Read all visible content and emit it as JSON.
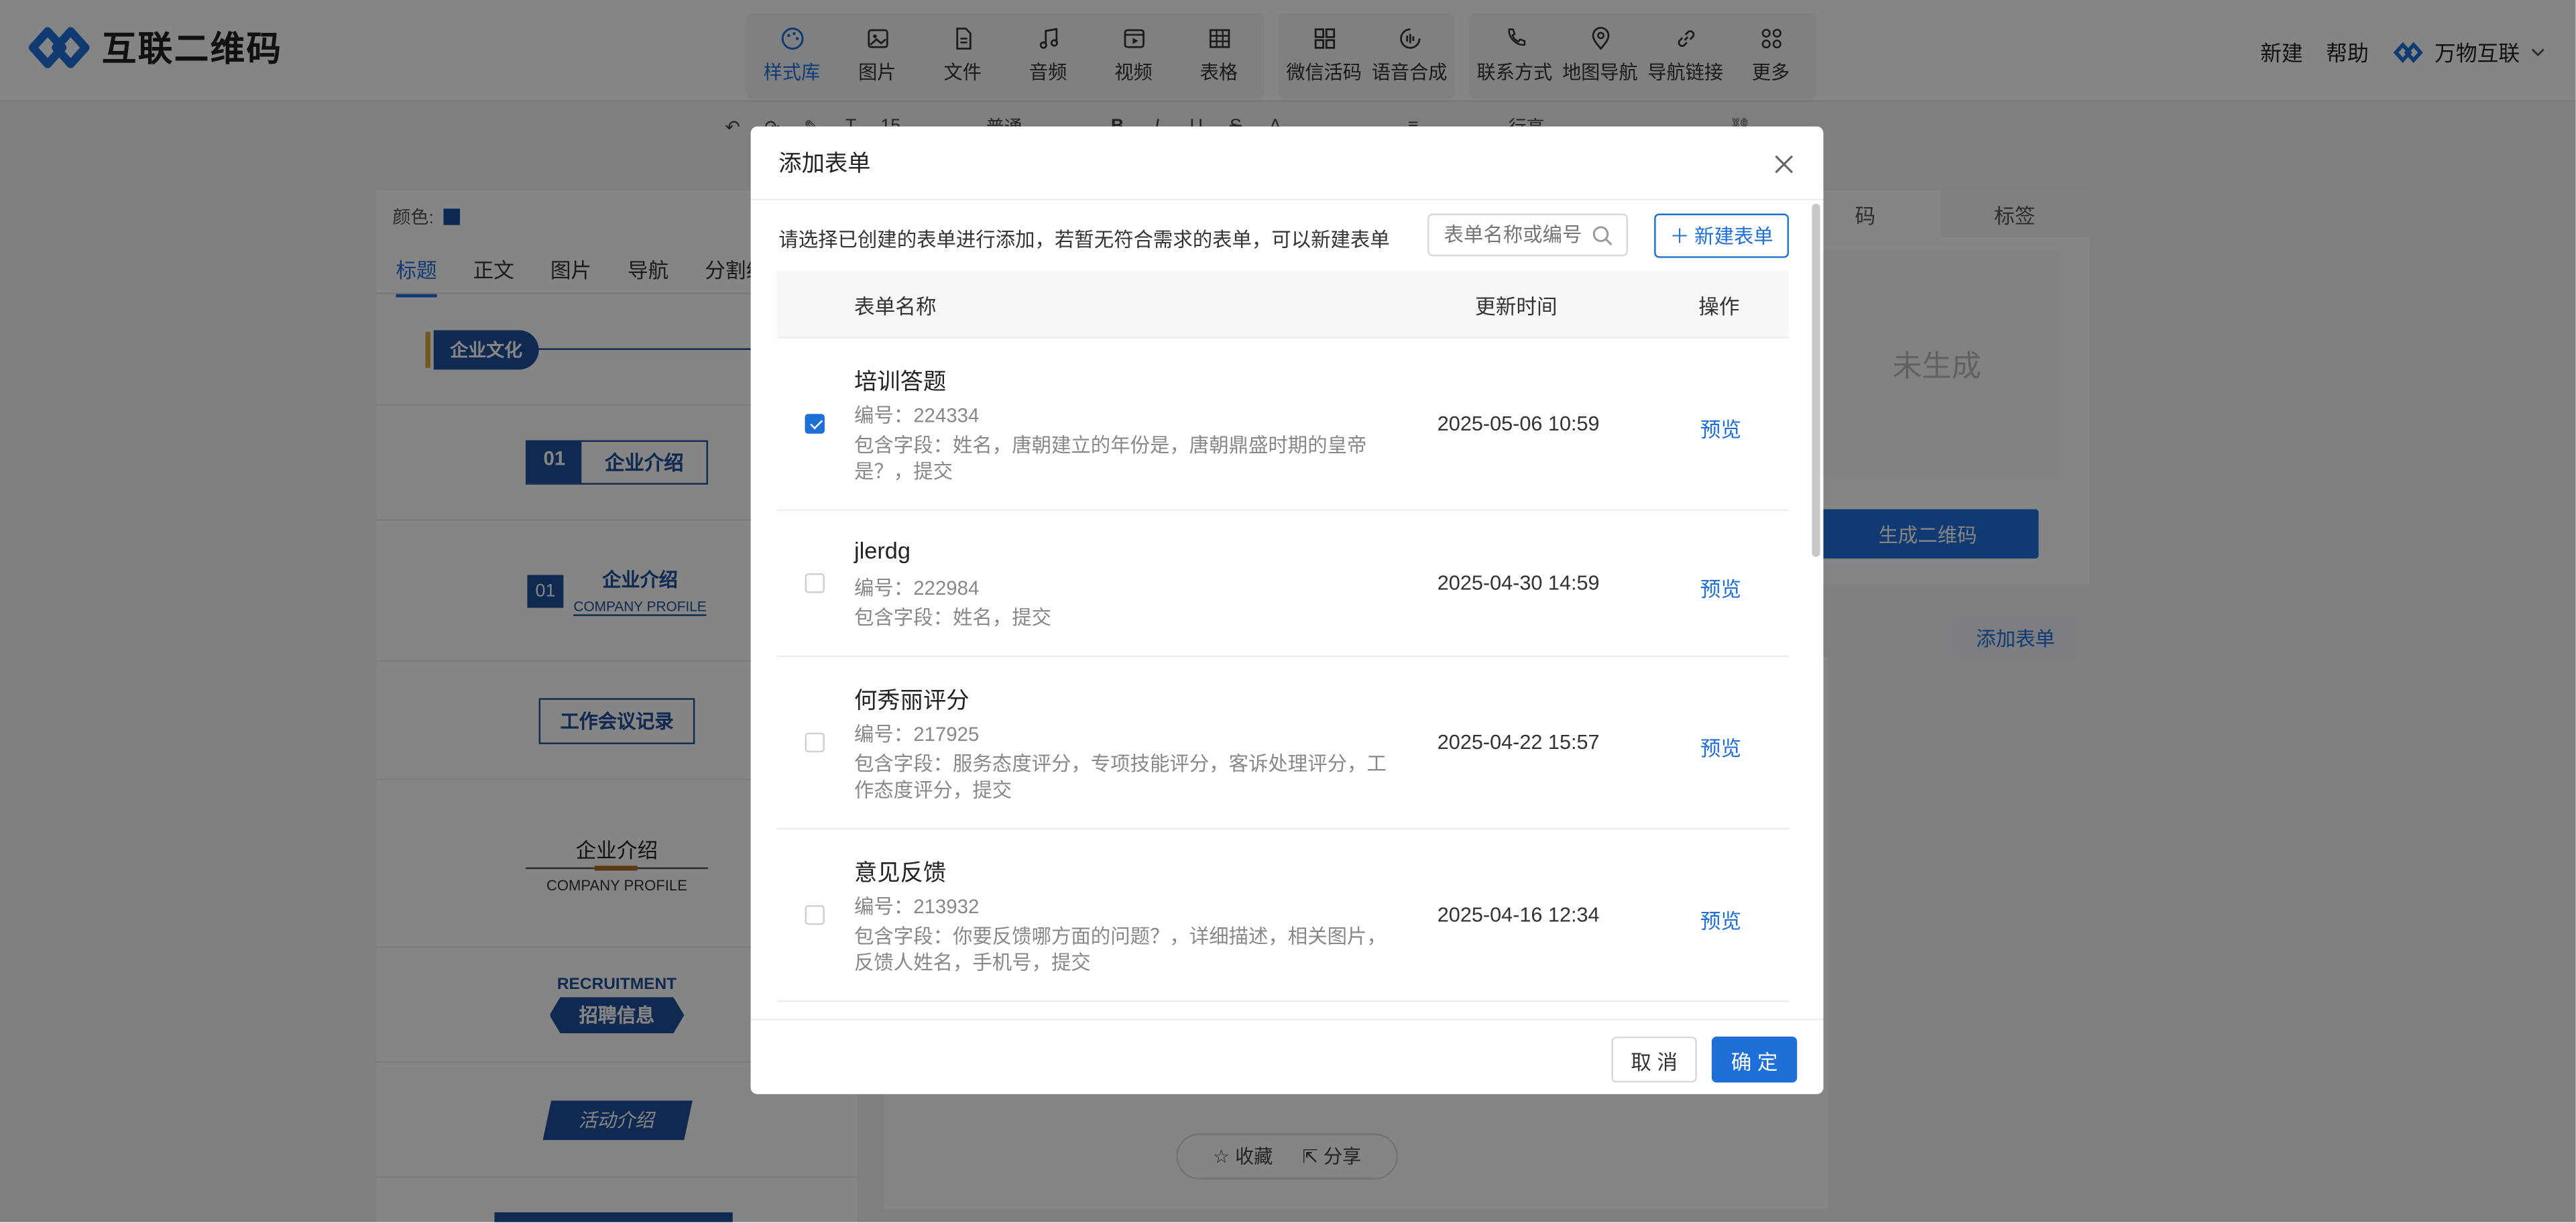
{
  "app": {
    "logo_text": "互联二维码",
    "top_links": [
      "新建",
      "帮助"
    ],
    "brand_name": "万物互联"
  },
  "nav": {
    "groups": [
      [
        {
          "label": "样式库",
          "icon": "palette-icon",
          "active": true
        },
        {
          "label": "图片",
          "icon": "image-icon"
        },
        {
          "label": "文件",
          "icon": "file-icon"
        },
        {
          "label": "音频",
          "icon": "music-icon"
        },
        {
          "label": "视频",
          "icon": "video-icon"
        },
        {
          "label": "表格",
          "icon": "table-icon"
        }
      ],
      [
        {
          "label": "微信活码",
          "icon": "grid-icon"
        },
        {
          "label": "语音合成",
          "icon": "voice-icon"
        }
      ],
      [
        {
          "label": "联系方式",
          "icon": "phone-icon"
        },
        {
          "label": "地图导航",
          "icon": "map-pin-icon"
        },
        {
          "label": "导航链接",
          "icon": "link-icon"
        },
        {
          "label": "更多",
          "icon": "more-grid-icon"
        }
      ]
    ]
  },
  "editor": {
    "font_size": "15",
    "paragraph_style": "普通",
    "line_height": "行高"
  },
  "left_panel": {
    "color_label": "颜色:",
    "color_value": "#1a4fa0",
    "tabs": [
      "标题",
      "正文",
      "图片",
      "导航",
      "分割线"
    ],
    "active_tab": "标题",
    "styles": {
      "s1": "企业文化",
      "s2_num": "01",
      "s2_text": "企业介绍",
      "s3_num": "01",
      "s3_text": "企业介绍",
      "s3_sub": "COMPANY PROFILE",
      "s4": "工作会议记录",
      "s5_text": "企业介绍",
      "s5_sub": "COMPANY PROFILE",
      "s6_en": "RECRUITMENT",
      "s6_cn": "招聘信息",
      "s7": "活动介绍"
    }
  },
  "center": {
    "favorite": "收藏",
    "share": "分享"
  },
  "right_panel": {
    "tabs": [
      "码",
      "标签"
    ],
    "qr_placeholder": "未生成",
    "generate_btn": "生成二维码",
    "add_form_btn": "添加表单"
  },
  "modal": {
    "title": "添加表单",
    "intro": "请选择已创建的表单进行添加，若暂无符合需求的表单，可以新建表单",
    "search_placeholder": "表单名称或编号",
    "new_button": "新建表单",
    "columns": {
      "name": "表单名称",
      "time": "更新时间",
      "op": "操作"
    },
    "code_prefix": "编号：",
    "rows": [
      {
        "name": "培训答题",
        "code": "编号：224334",
        "fields": "包含字段：姓名，唐朝建立的年份是，唐朝鼎盛时期的皇帝是？，提交",
        "time": "2025-05-06 10:59",
        "action": "预览",
        "checked": true
      },
      {
        "name": "jlerdg",
        "code": "编号：222984",
        "fields": "包含字段：姓名，提交",
        "time": "2025-04-30 14:59",
        "action": "预览",
        "checked": false
      },
      {
        "name": "何秀丽评分",
        "code": "编号：217925",
        "fields": "包含字段：服务态度评分，专项技能评分，客诉处理评分，工作态度评分，提交",
        "time": "2025-04-22 15:57",
        "action": "预览",
        "checked": false
      },
      {
        "name": "意见反馈",
        "code": "编号：213932",
        "fields": "包含字段：你要反馈哪方面的问题？，详细描述，相关图片，反馈人姓名，手机号，提交",
        "time": "2025-04-16 12:34",
        "action": "预览",
        "checked": false
      }
    ],
    "cancel": "取 消",
    "confirm": "确 定"
  },
  "colors": {
    "accent": "#1f6fd8",
    "overlay": "rgba(0,0,0,0.48)"
  }
}
